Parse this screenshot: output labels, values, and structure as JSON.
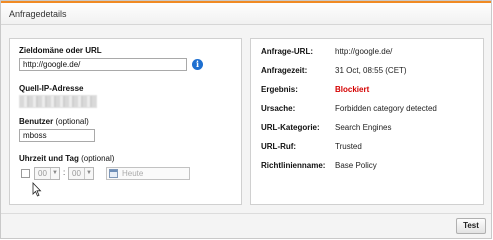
{
  "header": {
    "title": "Anfragedetails",
    "accent_color": "#f08a24"
  },
  "form": {
    "domain_label": "Zieldomäne oder URL",
    "domain_value": "http://google.de/",
    "info_icon": "i",
    "source_ip_label": "Quell-IP-Adresse",
    "user_label": "Benutzer",
    "user_label_optional": "(optional)",
    "user_value": "mboss",
    "time_label": "Uhrzeit und Tag",
    "time_label_optional": "(optional)",
    "hour_value": "00",
    "minute_value": "00",
    "time_separator": ":",
    "date_placeholder": "Heute"
  },
  "details": [
    {
      "key": "Anfrage-URL:",
      "value": "http://google.de/"
    },
    {
      "key": "Anfragezeit:",
      "value": "31 Oct, 08:55 (CET)"
    },
    {
      "key": "Ergebnis:",
      "value": "Blockiert",
      "color": "#d40000"
    },
    {
      "key": "Ursache:",
      "value": "Forbidden category detected"
    },
    {
      "key": "URL-Kategorie:",
      "value": "Search Engines"
    },
    {
      "key": "URL-Ruf:",
      "value": "Trusted"
    },
    {
      "key": "Richtlinienname:",
      "value": "Base Policy"
    }
  ],
  "footer": {
    "test_button": "Test"
  }
}
